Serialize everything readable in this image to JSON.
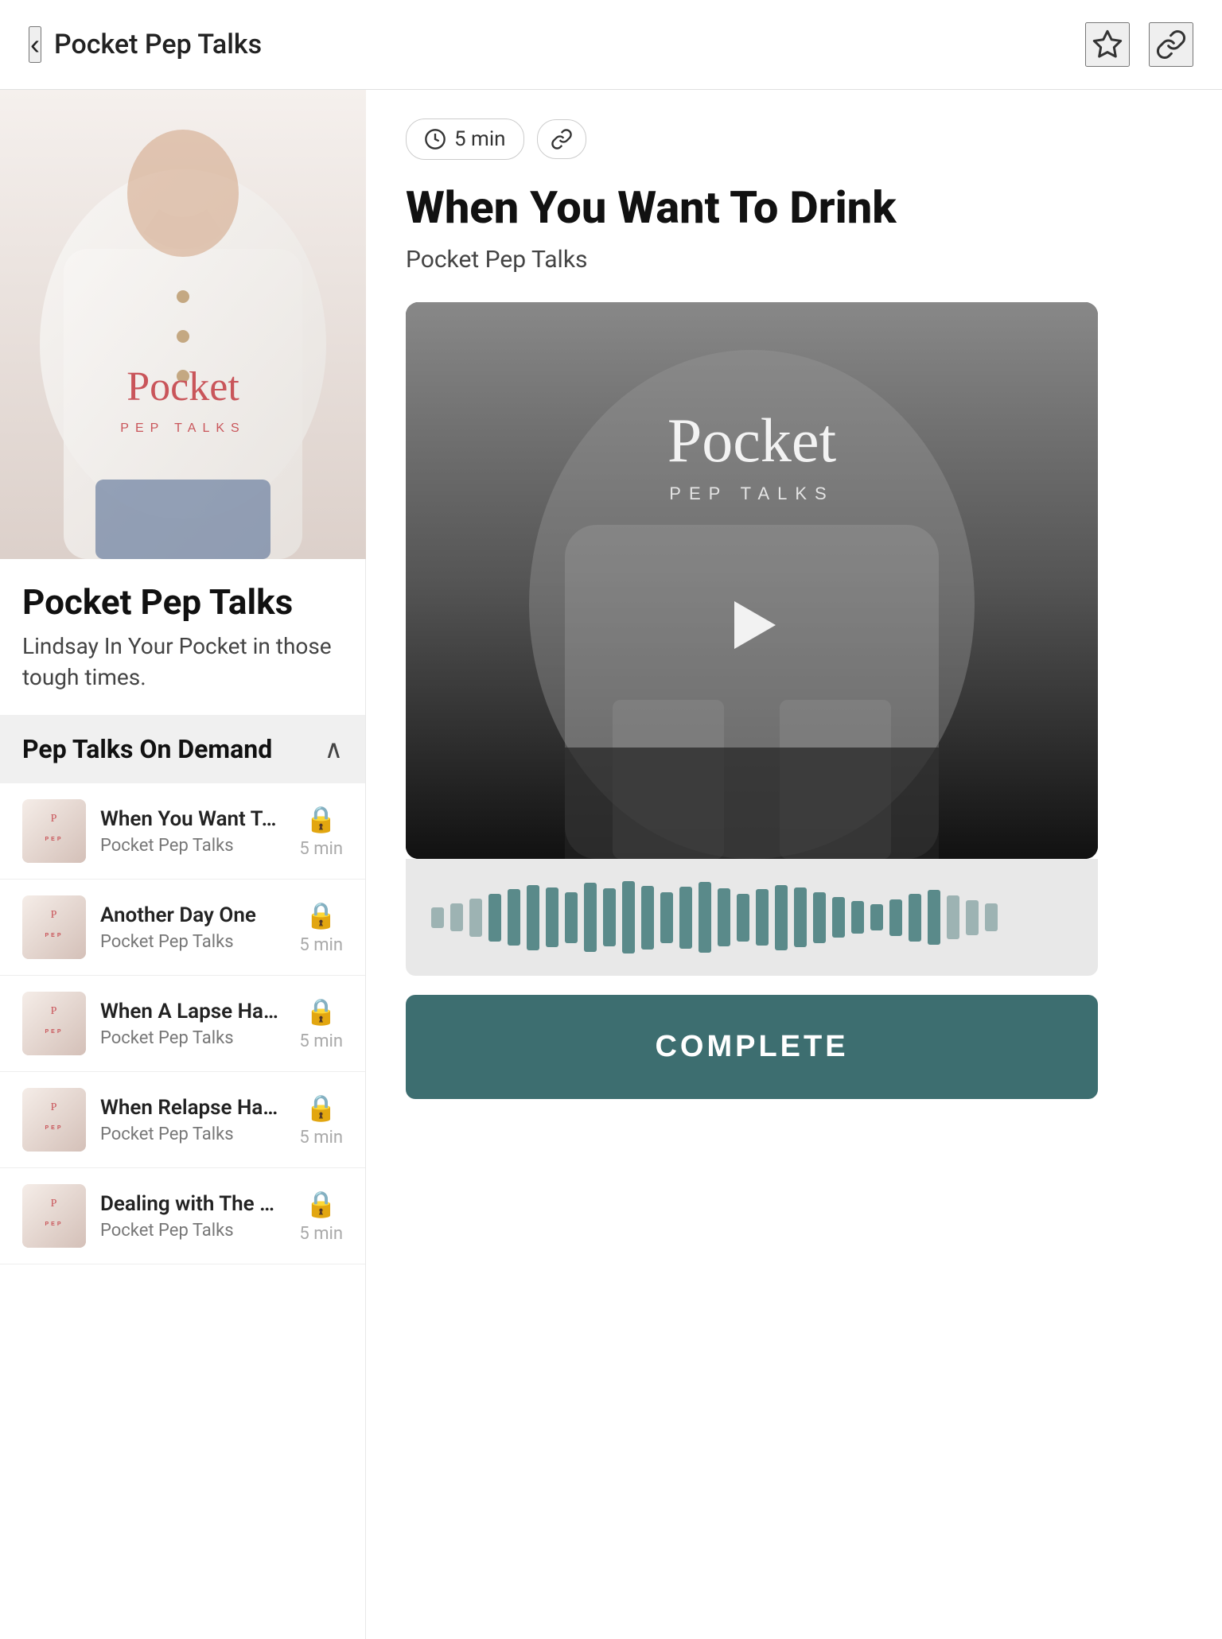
{
  "header": {
    "back_label": "‹",
    "title": "Pocket Pep Talks",
    "bookmark_icon": "☆",
    "link_icon": "⚇"
  },
  "left_panel": {
    "cover": {
      "logo_p": "P",
      "logo_ocket": "ocket",
      "logo_sub": "PEP TALKS"
    },
    "podcast_name": "Pocket Pep Talks",
    "podcast_desc": "Lindsay In Your Pocket in those tough times.",
    "section_title": "Pep Talks On Demand",
    "episodes": [
      {
        "title": "When You Want To Drink",
        "podcast": "Pocket Pep Talks",
        "duration": "5 min",
        "locked": true
      },
      {
        "title": "Another Day One",
        "podcast": "Pocket Pep Talks",
        "duration": "5 min",
        "locked": true
      },
      {
        "title": "When A Lapse Happens",
        "podcast": "Pocket Pep Talks",
        "duration": "5 min",
        "locked": true
      },
      {
        "title": "When Relapse Happens",
        "podcast": "Pocket Pep Talks",
        "duration": "5 min",
        "locked": true
      },
      {
        "title": "Dealing with The Shame Shower",
        "podcast": "Pocket Pep Talks",
        "duration": "5 min",
        "locked": true
      }
    ]
  },
  "right_panel": {
    "duration": "5 min",
    "episode_title": "When You Want To Drink",
    "podcast_name": "Pocket Pep Talks",
    "video_logo_text": "Pocket",
    "video_logo_sub": "PEP TALKS",
    "complete_label": "COMPLETE"
  },
  "waveform": {
    "bars": [
      18,
      28,
      42,
      55,
      68,
      80,
      72,
      60,
      85,
      70,
      90,
      78,
      60,
      75,
      88,
      70,
      55,
      68,
      80,
      72,
      60,
      45,
      35,
      25,
      40,
      55,
      65,
      50,
      38,
      28
    ]
  }
}
